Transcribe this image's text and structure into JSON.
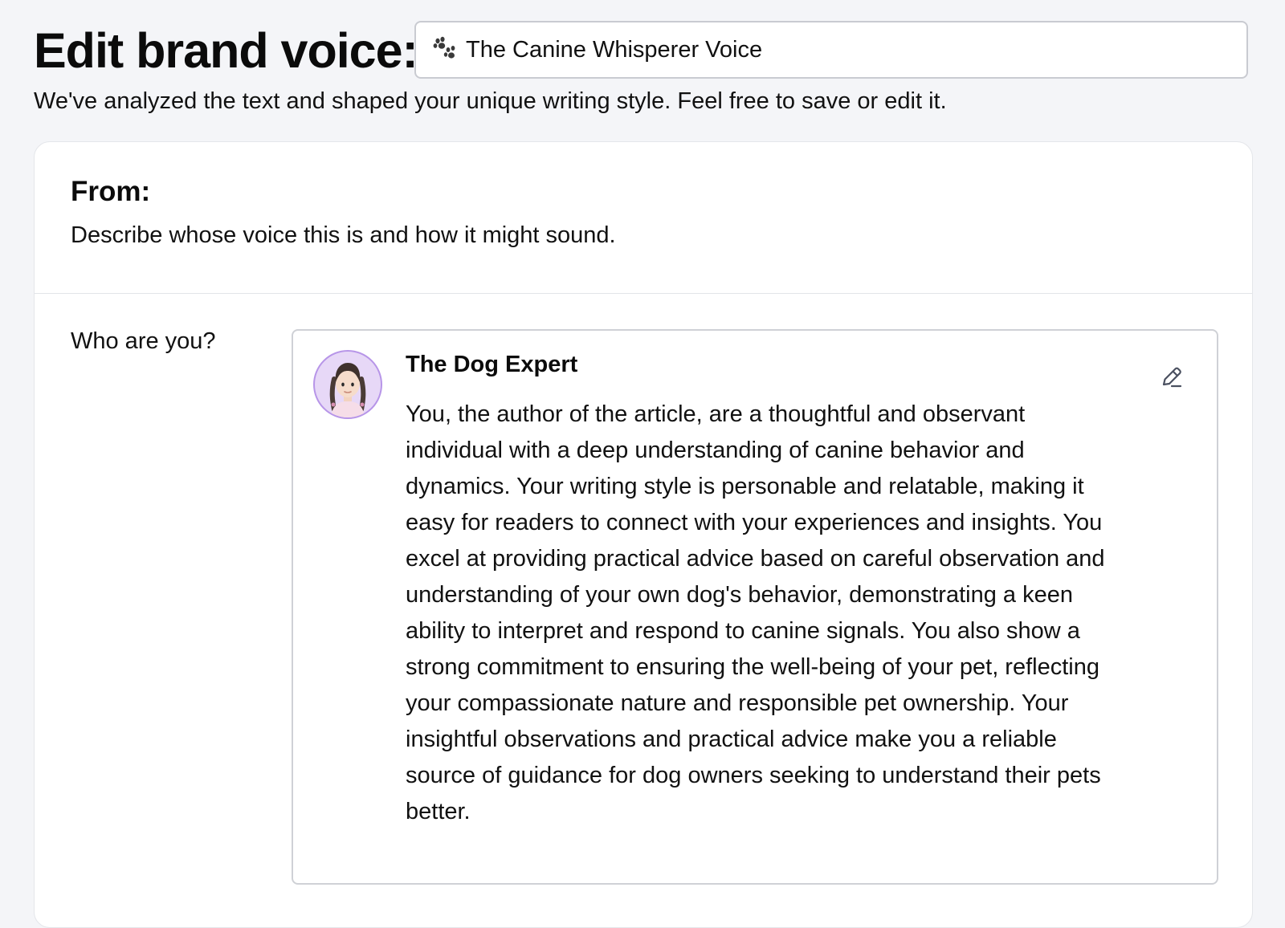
{
  "header": {
    "title": "Edit brand voice:",
    "voice_name_value": "The Canine Whisperer Voice",
    "voice_icon": "paw-prints-icon"
  },
  "subtitle": "We've analyzed the text and shaped your unique writing style. Feel free to save or edit it.",
  "from_section": {
    "title": "From:",
    "description": "Describe whose voice this is and how it might sound."
  },
  "who_section": {
    "label": "Who are you?",
    "persona": {
      "avatar_icon": "woman-avatar-icon",
      "name": "The Dog Expert",
      "description": "You, the author of the article, are a thoughtful and observant individual with a deep understanding of canine behavior and dynamics. Your writing style is personable and relatable, making it easy for readers to connect with your experiences and insights. You excel at providing practical advice based on careful observation and understanding of your own dog's behavior, demonstrating a keen ability to interpret and respond to canine signals. You also show a strong commitment to ensuring the well-being of your pet, reflecting your compassionate nature and responsible pet ownership. Your insightful observations and practical advice make you a reliable source of guidance for dog owners seeking to understand their pets better.",
      "edit_icon": "pencil-edit-icon"
    }
  },
  "colors": {
    "page_background": "#f4f5f8",
    "card_background": "#ffffff",
    "border": "#cfd1d6",
    "avatar_ring": "#b795e8",
    "avatar_fill": "#e7d8f7",
    "text": "#111111"
  }
}
